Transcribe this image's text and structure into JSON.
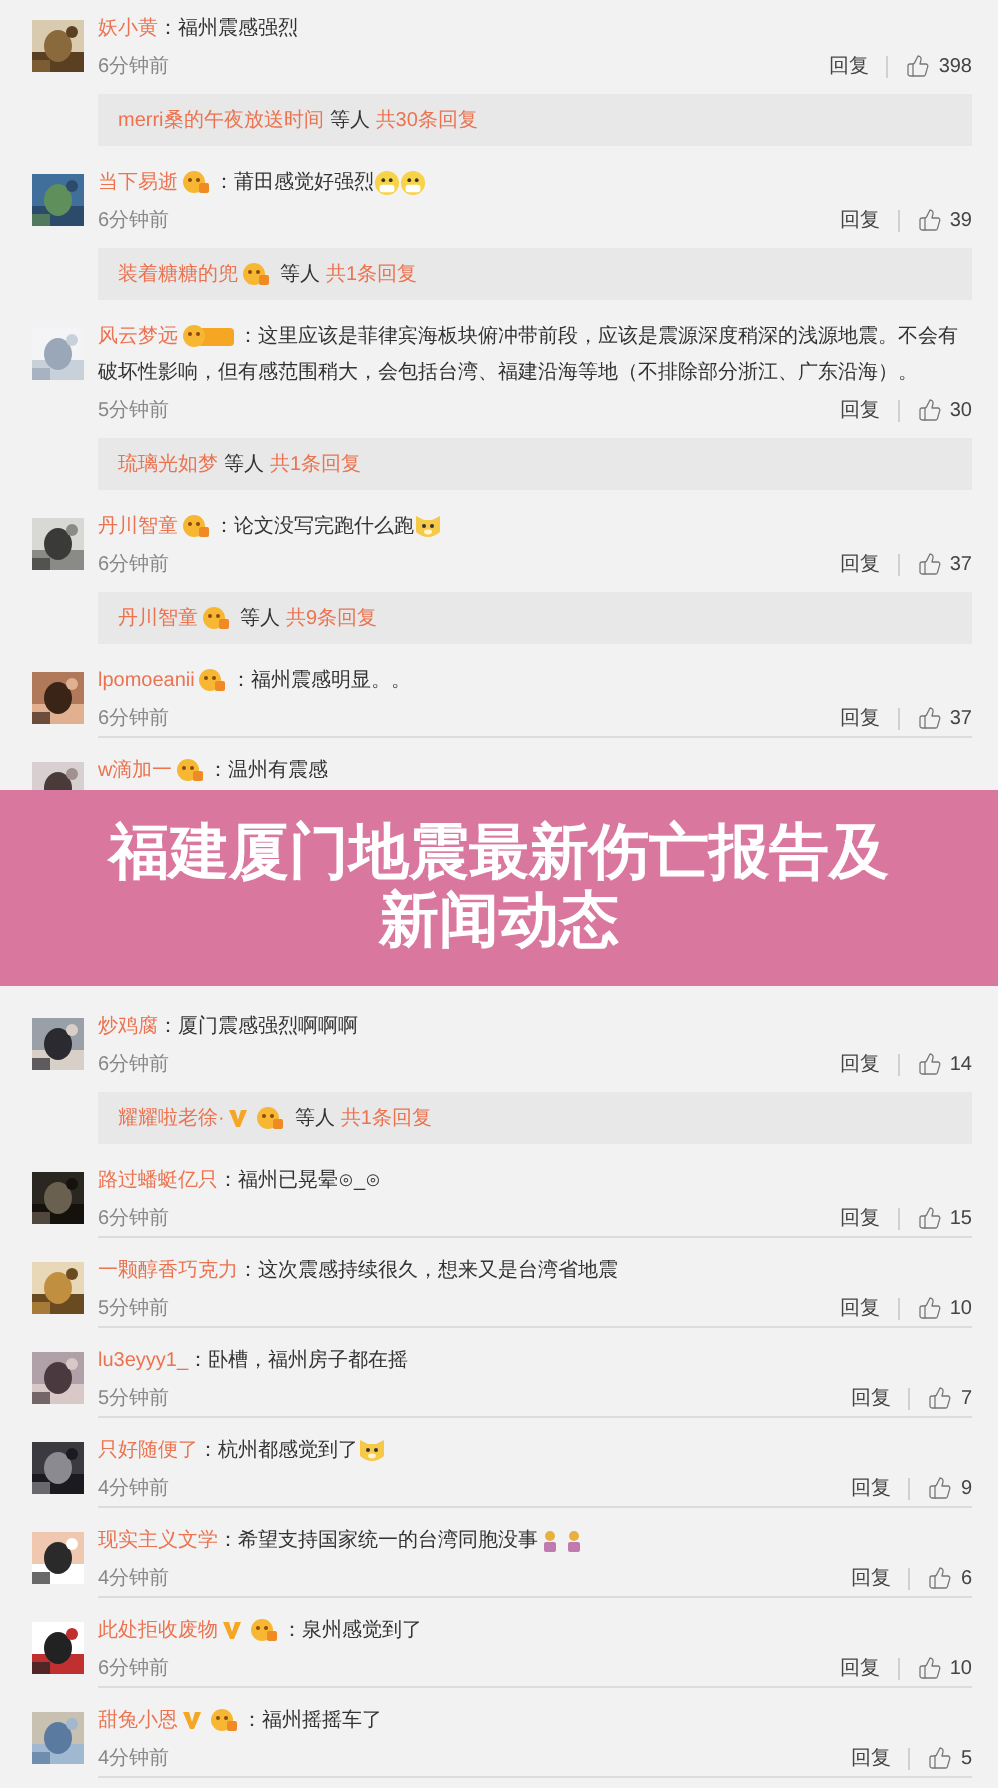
{
  "comments": [
    {
      "user": "妖小黄",
      "text": "：福州震感强烈",
      "time": "6分钟前",
      "reply": "回复",
      "likes": "398",
      "replies": {
        "users": [
          {
            "name": "merri桑的午夜放送时间"
          }
        ],
        "others": "等人",
        "total": "共30条回复"
      }
    },
    {
      "user": "当下易逝",
      "badges": [
        {
          "kind": "fan"
        }
      ],
      "text": "：莆田感觉好强烈",
      "emojis": [
        {
          "kind": "face"
        },
        {
          "kind": "face"
        }
      ],
      "time": "6分钟前",
      "reply": "回复",
      "likes": "39",
      "replies": {
        "users": [
          {
            "name": "装着糖糖的兜",
            "badges": [
              {
                "kind": "fan"
              }
            ]
          }
        ],
        "others": "等人",
        "total": "共1条回复"
      }
    },
    {
      "user": "风云梦远",
      "badges": [
        {
          "kind": "fan_tag"
        }
      ],
      "text": "：这里应该是菲律宾海板块俯冲带前段，应该是震源深度稍深的浅源地震。不会有破坏性影响，但有感范围稍大，会包括台湾、福建沿海等地（不排除部分浙江、广东沿海）。",
      "time": "5分钟前",
      "reply": "回复",
      "likes": "30",
      "replies": {
        "users": [
          {
            "name": "琉璃光如梦"
          }
        ],
        "others": "等人",
        "total": "共1条回复"
      }
    },
    {
      "user": "丹川智童",
      "badges": [
        {
          "kind": "fan"
        }
      ],
      "text": "：论文没写完跑什么跑",
      "emojis": [
        {
          "kind": "dog"
        }
      ],
      "time": "6分钟前",
      "reply": "回复",
      "likes": "37",
      "replies": {
        "users": [
          {
            "name": "丹川智童",
            "badges": [
              {
                "kind": "fan"
              }
            ]
          }
        ],
        "others": "等人",
        "total": "共9条回复"
      }
    },
    {
      "user": "lpomoeanii",
      "badges": [
        {
          "kind": "fan"
        }
      ],
      "text": "：福州震感明显。。",
      "time": "6分钟前",
      "reply": "回复",
      "likes": "37"
    },
    {
      "user": "w滴加一",
      "badges": [
        {
          "kind": "fan"
        }
      ],
      "text": "：温州有震感"
    }
  ],
  "banner": {
    "title": "福建厦门地震最新伤亡报告及新闻动态"
  },
  "more_comments": [
    {
      "user": "炒鸡腐",
      "text": "：厦门震感强烈啊啊啊",
      "time": "6分钟前",
      "reply": "回复",
      "likes": "14",
      "replies": {
        "users": [
          {
            "name": "耀耀啦老徐·",
            "badges": [
              {
                "kind": "vip"
              },
              {
                "kind": "fan"
              }
            ]
          }
        ],
        "others": "等人",
        "total": "共1条回复"
      }
    },
    {
      "user": "路过蟠蜓亿只",
      "text": "：福州已晃晕⊙_⊙",
      "time": "6分钟前",
      "reply": "回复",
      "likes": "15"
    },
    {
      "user": "一颗醇香巧克力",
      "text": "：这次震感持续很久，想来又是台湾省地震",
      "time": "5分钟前",
      "reply": "回复",
      "likes": "10"
    },
    {
      "user": "lu3eyyy1_",
      "text": "：卧槽，福州房子都在摇",
      "time": "5分钟前",
      "reply": "回复",
      "likes": "7"
    },
    {
      "user": "只好随便了",
      "text": "：杭州都感觉到了",
      "emojis": [
        {
          "kind": "dog"
        }
      ],
      "time": "4分钟前",
      "reply": "回复",
      "likes": "9"
    },
    {
      "user": "现实主义文学",
      "text": "：希望支持国家统一的台湾同胞没事",
      "emojis": [
        {
          "kind": "pray"
        },
        {
          "kind": "pray"
        }
      ],
      "time": "4分钟前",
      "reply": "回复",
      "likes": "6"
    },
    {
      "user": "此处拒收废物",
      "badges": [
        {
          "kind": "vip"
        },
        {
          "kind": "fan"
        }
      ],
      "text": "：泉州感觉到了",
      "time": "6分钟前",
      "reply": "回复",
      "likes": "10"
    },
    {
      "user": "甜兔小恩",
      "badges": [
        {
          "kind": "vip"
        },
        {
          "kind": "fan"
        }
      ],
      "text": "：福州摇摇车了",
      "time": "4分钟前",
      "reply": "回复",
      "likes": "5"
    }
  ]
}
